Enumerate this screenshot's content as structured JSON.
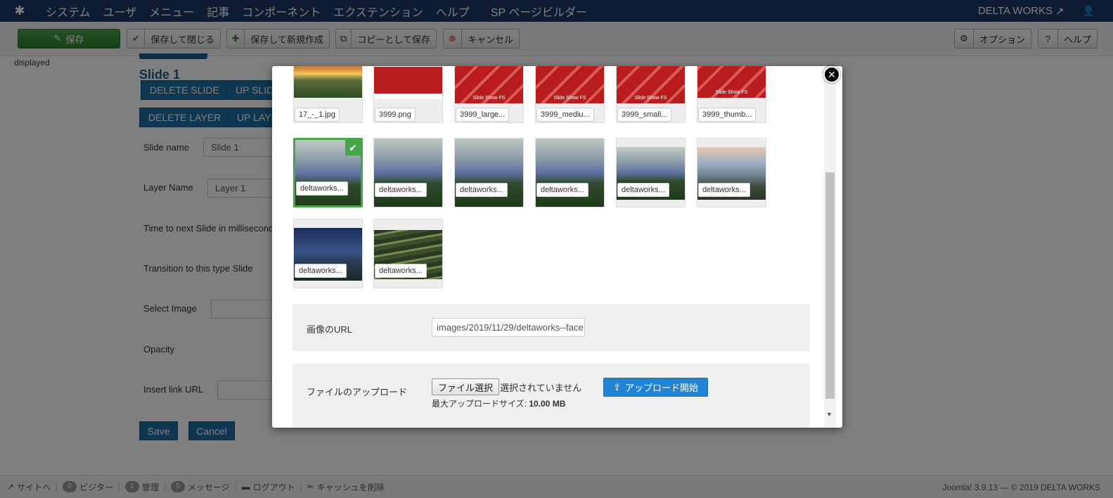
{
  "navbar": {
    "logo_icon": "joomla-icon",
    "menu": [
      "システム",
      "ユーザ",
      "メニュー",
      "記事",
      "コンポーネント",
      "エクステンション",
      "ヘルプ",
      "SP ページビルダー"
    ],
    "site_name": "DELTA WORKS",
    "site_icon": "external-link-icon",
    "user_icon": "user-icon"
  },
  "toolbar": {
    "save_label": "保存",
    "save_close_label": "保存して閉じる",
    "save_new_label": "保存して新規作成",
    "save_copy_label": "コピーとして保存",
    "cancel_label": "キャンセル",
    "options_label": "オプション",
    "help_label": "ヘルプ"
  },
  "page": {
    "displayed_text": "displayed",
    "slide_title": "Slide 1",
    "delete_slide_label": "DELETE SLIDE",
    "up_slide_label": "UP SLIDE",
    "delete_layer_label": "DELETE LAYER",
    "up_layer_label": "UP LAYER",
    "fields": {
      "slide_name_label": "Slide name",
      "slide_name_value": "Slide 1",
      "layer_name_label": "Layer Name",
      "layer_name_value": "Layer 1",
      "time_label": "Time to next Slide in milliseconds",
      "transition_label": "Transition to this type Slide",
      "select_image_label": "Select Image",
      "opacity_label": "Opacity",
      "insert_link_label": "Insert link URL"
    },
    "save_label": "Save",
    "cancel_label": "Cancel"
  },
  "statusbar": {
    "site_label": "サイトへ",
    "visitors_count": "0",
    "visitors_label": "ビジター",
    "admin_count": "1",
    "admin_label": "管理",
    "messages_count": "0",
    "messages_label": "メッセージ",
    "logout_label": "ログアウト",
    "clear_cache_label": "キャッシュを削除",
    "version_text": "Joomla! 3.9.13 — © 2019 DELTA WORKS"
  },
  "media_modal": {
    "images": [
      {
        "name": "17_-_1.jpg",
        "kind": "sunset",
        "selected": false
      },
      {
        "name": "3999.png",
        "kind": "screen",
        "selected": false
      },
      {
        "name": "3999_large...",
        "kind": "red",
        "selected": false
      },
      {
        "name": "3999_mediu...",
        "kind": "red",
        "selected": false
      },
      {
        "name": "3999_small...",
        "kind": "red",
        "selected": false
      },
      {
        "name": "3999_thumb...",
        "kind": "red-small",
        "selected": false
      },
      {
        "name": "deltaworks...",
        "kind": "landscape",
        "selected": true
      },
      {
        "name": "deltaworks...",
        "kind": "landscape",
        "selected": false
      },
      {
        "name": "deltaworks...",
        "kind": "landscape",
        "selected": false
      },
      {
        "name": "deltaworks...",
        "kind": "landscape",
        "selected": false
      },
      {
        "name": "deltaworks...",
        "kind": "landscape-small",
        "selected": false
      },
      {
        "name": "deltaworks...",
        "kind": "coast",
        "selected": false
      },
      {
        "name": "deltaworks...",
        "kind": "night",
        "selected": false
      },
      {
        "name": "deltaworks...",
        "kind": "terraces",
        "selected": false
      }
    ],
    "url_label": "画像のURL",
    "url_value": "images/2019/11/29/deltaworks--face",
    "upload_label": "ファイルのアップロード",
    "choose_file_label": "ファイル選択",
    "no_file_text": "選択されていません",
    "upload_button_label": "アップロード開始",
    "max_size_label": "最大アップロードサイズ:",
    "max_size_value": "10.00 MB",
    "red_thumb_text": "Slide Show FS",
    "colors": {
      "selected": "#46a546",
      "upload": "#2384d3",
      "red_thumb": "#b81c1c"
    }
  }
}
